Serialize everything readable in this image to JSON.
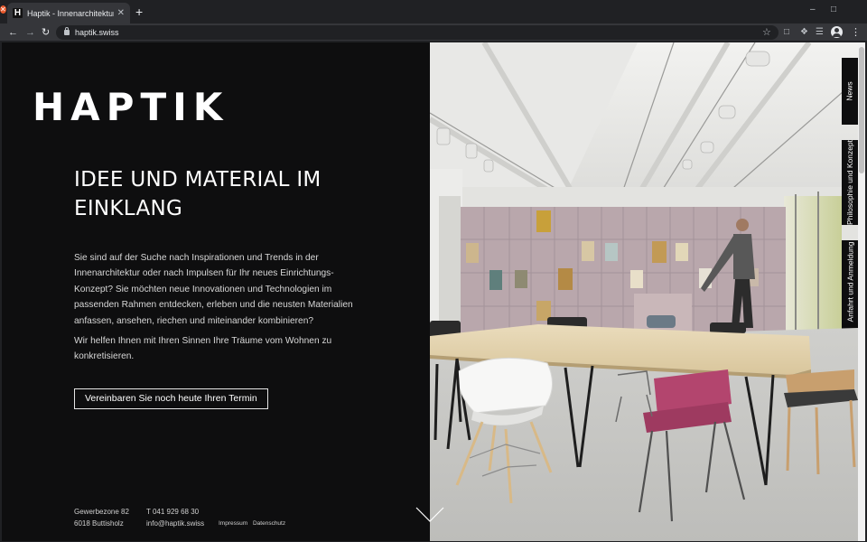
{
  "browser": {
    "tab_title": "Haptik - Innenarchitektur",
    "tab_favicon": "H",
    "tab_close": "✕",
    "new_tab": "+",
    "url": "haptik.swiss",
    "icons": [
      "back-arrow-icon",
      "forward-arrow-icon",
      "reload-icon",
      "lock-icon",
      "star-icon",
      "screenshot-icon",
      "puzzle-icon",
      "media-icon",
      "profile-icon",
      "menu-icon"
    ]
  },
  "page": {
    "logo": "HAPTIK",
    "headline": "IDEE UND MATERIAL IM EINKLANG",
    "paragraphs": [
      "Sie sind auf der Suche nach Inspirationen und Trends in der Innenarchitektur oder nach Impulsen für Ihr neues Einrichtungs-Konzept? Sie möchten neue Innovationen und Technologien im passenden Rahmen entdecken, erleben und die neusten Materialien anfassen, ansehen, riechen und miteinander kombinieren?",
      "Wir helfen Ihnen mit Ihren Sinnen Ihre Träume vom Wohnen zu konkretisieren."
    ],
    "cta": "Vereinbaren Sie noch heute Ihren Termin",
    "footer": {
      "address_line1": "Gewerbezone 82",
      "address_line2": "6018 Buttisholz",
      "phone": "T 041 929 68 30",
      "email": "info@haptik.swiss",
      "impressum": "Impressum",
      "datenschutz": "Datenschutz"
    },
    "side_tabs": [
      "News",
      "Philosophie und Konzept",
      "Anfahrt und Anmeldung"
    ],
    "colors": {
      "panel_bg": "#0e0e0f",
      "text": "#ffffff",
      "cabinet_wall": "#b9a7ac",
      "table_top": "#e6d7b4",
      "chair_pink": "#b3456e"
    }
  }
}
